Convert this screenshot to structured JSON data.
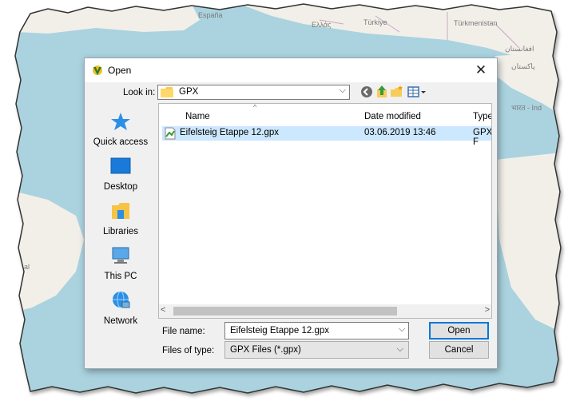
{
  "map": {
    "labels": [
      "España",
      "Ελλάς",
      "Türkiye",
      "Türkmenistan",
      "افغانستان",
      "پاکستان",
      "भारत - Ind",
      "al"
    ],
    "water_color": "#aad3df",
    "land_color": "#f2efe9"
  },
  "dialog": {
    "title": "Open",
    "close_label": "✕",
    "look_in_label": "Look in:",
    "look_in_value": "GPX",
    "places": [
      {
        "name": "quick-access",
        "label": "Quick access",
        "icon": "star-icon"
      },
      {
        "name": "desktop",
        "label": "Desktop",
        "icon": "desktop-icon"
      },
      {
        "name": "libraries",
        "label": "Libraries",
        "icon": "libraries-icon"
      },
      {
        "name": "this-pc",
        "label": "This PC",
        "icon": "computer-icon"
      },
      {
        "name": "network",
        "label": "Network",
        "icon": "network-icon"
      }
    ],
    "columns": {
      "name": "Name",
      "date": "Date modified",
      "type": "Type"
    },
    "files": [
      {
        "name": "Eifelsteig Etappe 12.gpx",
        "date": "03.06.2019 13:46",
        "type": "GPX F"
      }
    ],
    "file_name_label": "File name:",
    "file_name_value": "Eifelsteig Etappe 12.gpx",
    "file_type_label": "Files of type:",
    "file_type_value": "GPX Files (*.gpx)",
    "open_label": "Open",
    "cancel_label": "Cancel",
    "accent_color": "#0078d7",
    "selection_color": "#cce8ff"
  }
}
